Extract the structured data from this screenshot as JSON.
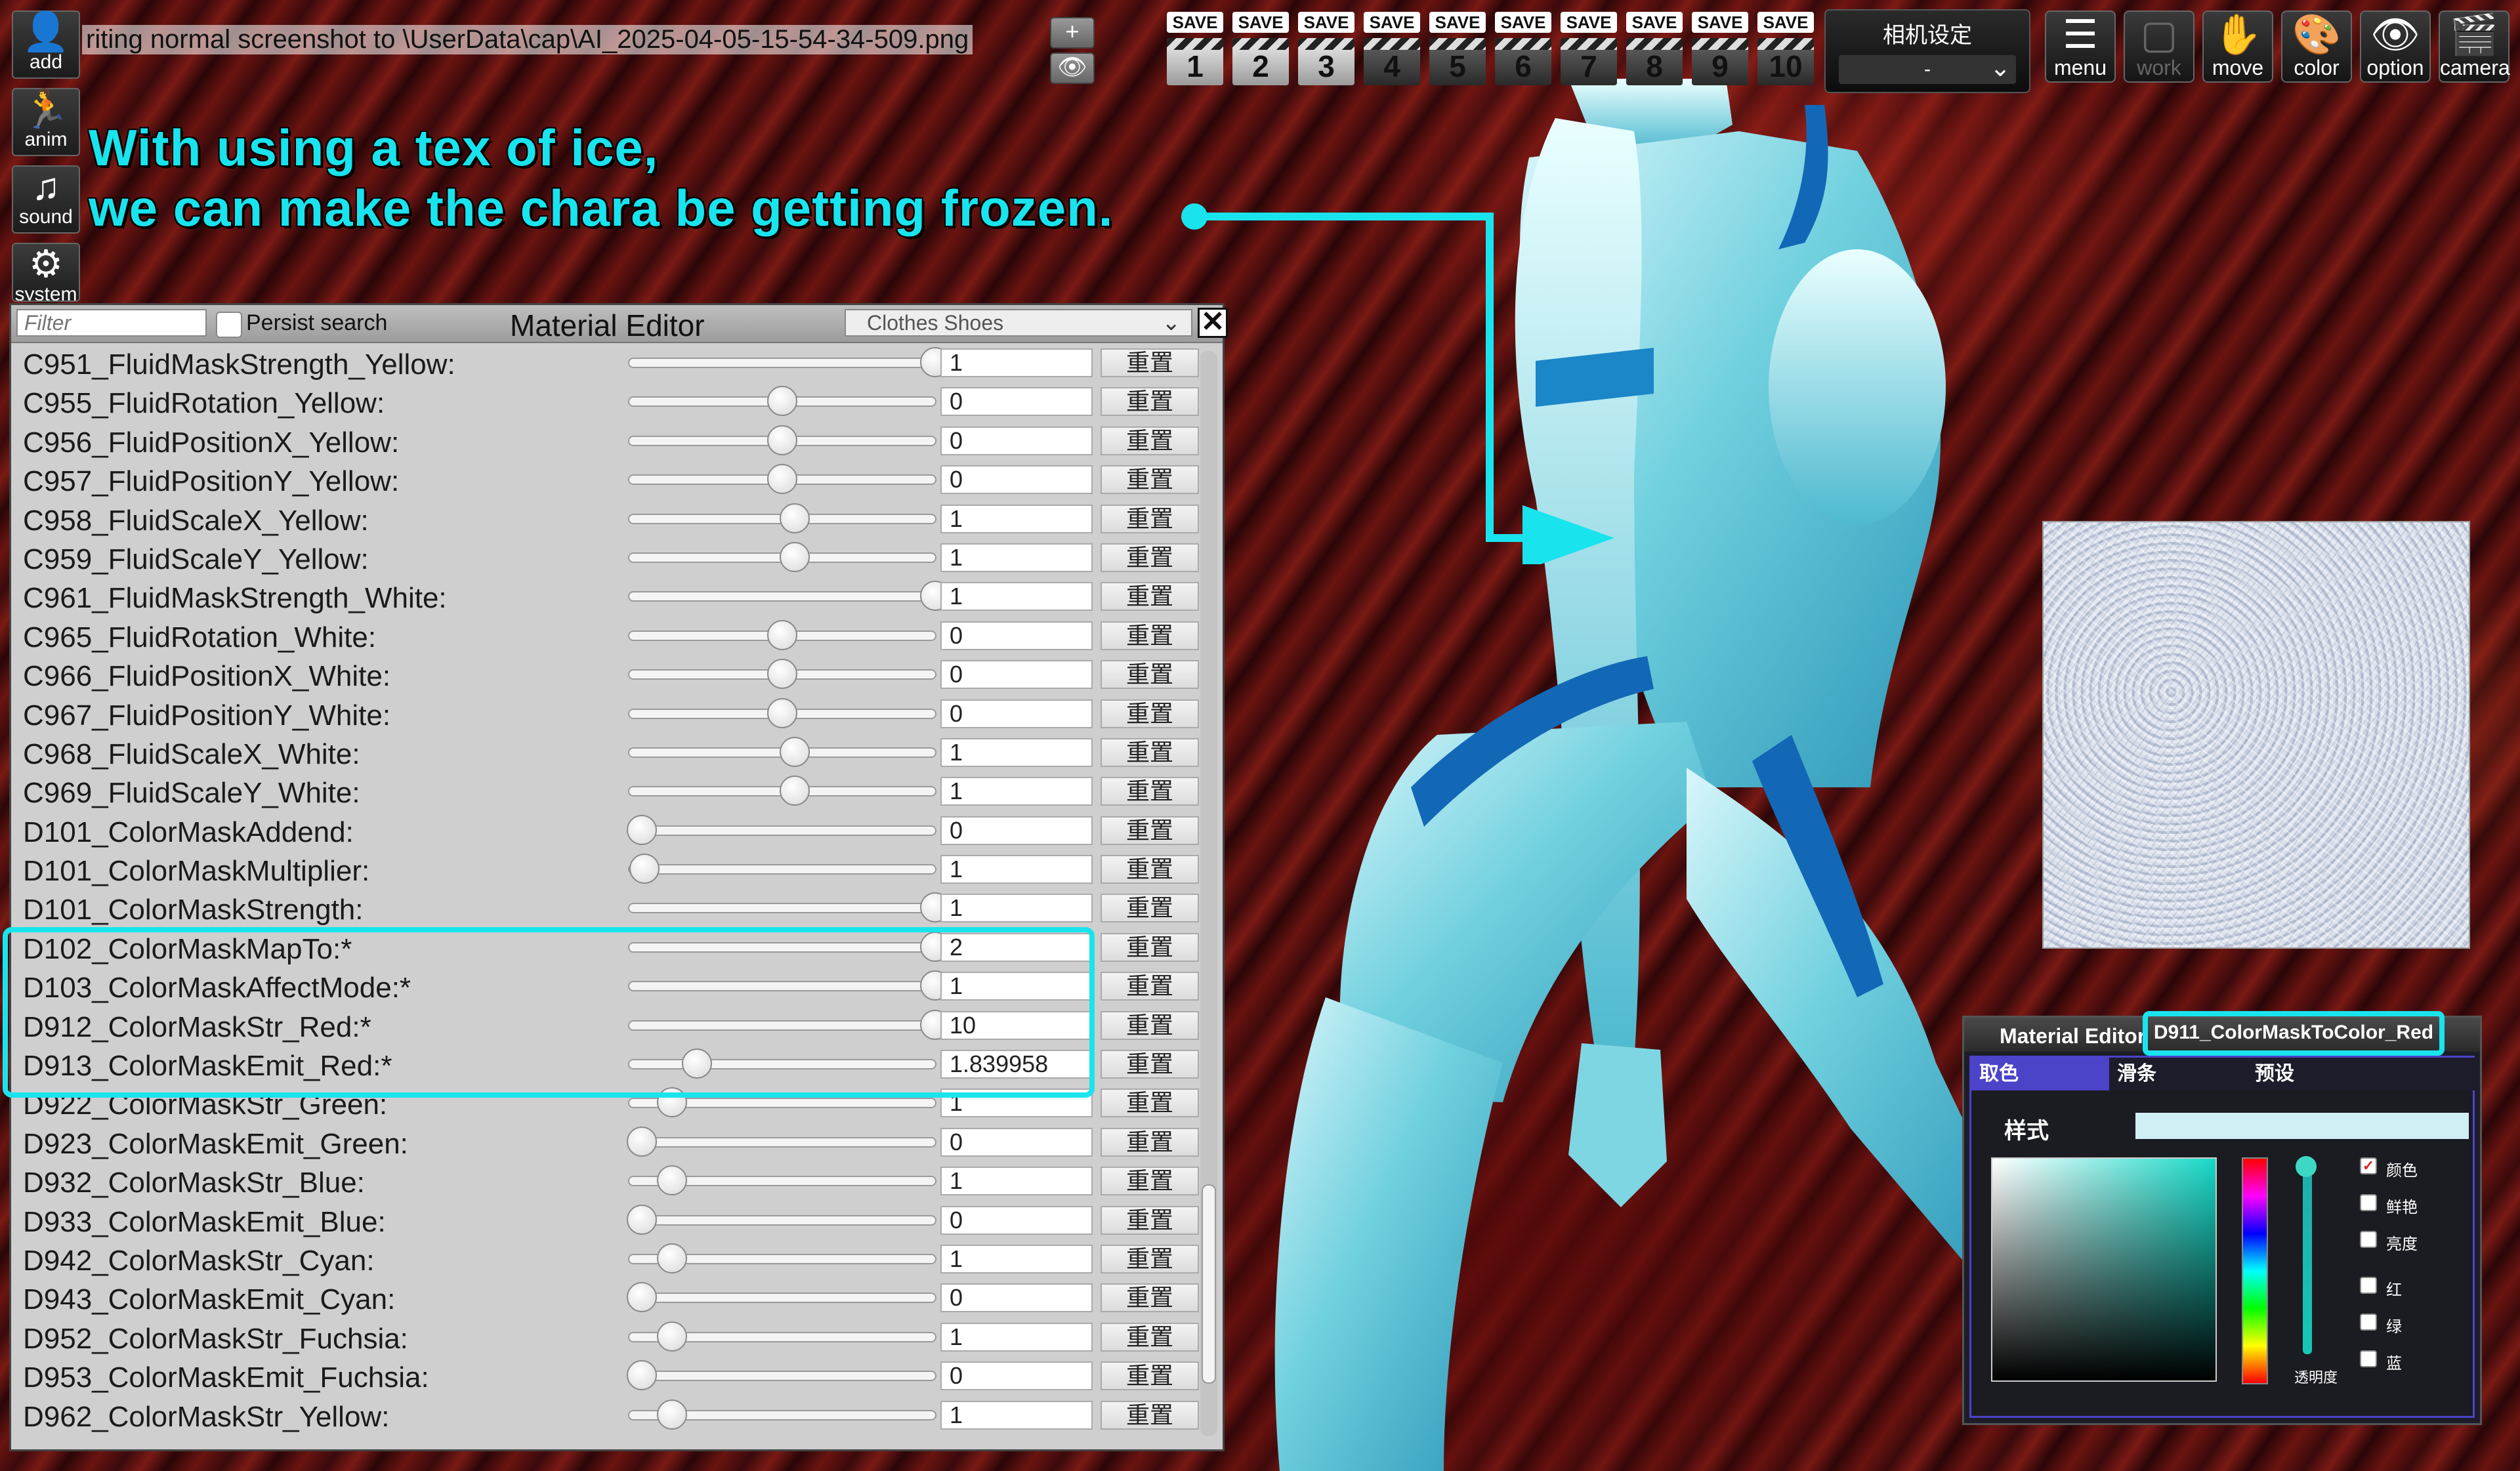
{
  "status": {
    "text": "riting normal screenshot to \\UserData\\cap\\AI_2025-04-05-15-54-34-509.png"
  },
  "left_tools": [
    {
      "label": "add",
      "icon": "add-person-icon"
    },
    {
      "label": "anim",
      "icon": "running-person-icon"
    },
    {
      "label": "sound",
      "icon": "music-note-icon"
    },
    {
      "label": "system",
      "icon": "gears-icon"
    }
  ],
  "caption": {
    "line1": "With using a tex of ice,",
    "line2": "we can make the chara be getting frozen.",
    "color": "#19e4ee"
  },
  "toolbar": {
    "plus": "+",
    "save_label": "SAVE",
    "slots": [
      "1",
      "2",
      "3",
      "4",
      "5",
      "6",
      "7",
      "8",
      "9",
      "10"
    ],
    "camera_setting_title": "相机设定",
    "camera_setting_value": "-",
    "right_tools": [
      {
        "label": "menu",
        "icon": "menu-list-icon"
      },
      {
        "label": "work",
        "icon": "work-icon"
      },
      {
        "label": "move",
        "icon": "hand-icon"
      },
      {
        "label": "color",
        "icon": "palette-icon"
      },
      {
        "label": "option",
        "icon": "eye-icon"
      },
      {
        "label": "camera",
        "icon": "camera-clapper-icon"
      }
    ]
  },
  "material_editor": {
    "filter_placeholder": "Filter",
    "persist_label": "Persist search",
    "title": "Material Editor",
    "category": "Clothes Shoes",
    "close": "✕",
    "reset_label": "重置",
    "rows": [
      {
        "name": "C951_FluidMaskStrength_Yellow:",
        "value": "1",
        "pos": 1.0
      },
      {
        "name": "C955_FluidRotation_Yellow:",
        "value": "0",
        "pos": 0.5
      },
      {
        "name": "C956_FluidPositionX_Yellow:",
        "value": "0",
        "pos": 0.5
      },
      {
        "name": "C957_FluidPositionY_Yellow:",
        "value": "0",
        "pos": 0.5
      },
      {
        "name": "C958_FluidScaleX_Yellow:",
        "value": "1",
        "pos": 0.54
      },
      {
        "name": "C959_FluidScaleY_Yellow:",
        "value": "1",
        "pos": 0.54
      },
      {
        "name": "C961_FluidMaskStrength_White:",
        "value": "1",
        "pos": 1.0
      },
      {
        "name": "C965_FluidRotation_White:",
        "value": "0",
        "pos": 0.5
      },
      {
        "name": "C966_FluidPositionX_White:",
        "value": "0",
        "pos": 0.5
      },
      {
        "name": "C967_FluidPositionY_White:",
        "value": "0",
        "pos": 0.5
      },
      {
        "name": "C968_FluidScaleX_White:",
        "value": "1",
        "pos": 0.54
      },
      {
        "name": "C969_FluidScaleY_White:",
        "value": "1",
        "pos": 0.54
      },
      {
        "name": "D101_ColorMaskAddend:",
        "value": "0",
        "pos": 0.04
      },
      {
        "name": "D101_ColorMaskMultiplier:",
        "value": "1",
        "pos": 0.05
      },
      {
        "name": "D101_ColorMaskStrength:",
        "value": "1",
        "pos": 1.0
      },
      {
        "name": "D102_ColorMaskMapTo:*",
        "value": "2",
        "pos": 1.0
      },
      {
        "name": "D103_ColorMaskAffectMode:*",
        "value": "1",
        "pos": 1.0
      },
      {
        "name": "D912_ColorMaskStr_Red:*",
        "value": "10",
        "pos": 1.0
      },
      {
        "name": "D913_ColorMaskEmit_Red:*",
        "value": "1.839958",
        "pos": 0.22
      },
      {
        "name": "D922_ColorMaskStr_Green:",
        "value": "1",
        "pos": 0.14
      },
      {
        "name": "D923_ColorMaskEmit_Green:",
        "value": "0",
        "pos": 0.04
      },
      {
        "name": "D932_ColorMaskStr_Blue:",
        "value": "1",
        "pos": 0.14
      },
      {
        "name": "D933_ColorMaskEmit_Blue:",
        "value": "0",
        "pos": 0.04
      },
      {
        "name": "D942_ColorMaskStr_Cyan:",
        "value": "1",
        "pos": 0.14
      },
      {
        "name": "D943_ColorMaskEmit_Cyan:",
        "value": "0",
        "pos": 0.04
      },
      {
        "name": "D952_ColorMaskStr_Fuchsia:",
        "value": "1",
        "pos": 0.14
      },
      {
        "name": "D953_ColorMaskEmit_Fuchsia:",
        "value": "0",
        "pos": 0.04
      },
      {
        "name": "D962_ColorMaskStr_Yellow:",
        "value": "1",
        "pos": 0.14
      }
    ]
  },
  "color_picker": {
    "title": "Material Editor",
    "property": "D911_ColorMaskToColor_Red",
    "tabs": [
      "取色",
      "滑条",
      "预设"
    ],
    "style_label": "样式",
    "current_color": "#cfeff4",
    "hue_color": "#17d9c8",
    "alpha_label": "透明度",
    "options": [
      {
        "label": "颜色",
        "checked": true
      },
      {
        "label": "鲜艳",
        "checked": false
      },
      {
        "label": "亮度",
        "checked": false
      },
      {
        "label": "红",
        "checked": false
      },
      {
        "label": "绿",
        "checked": false
      },
      {
        "label": "蓝",
        "checked": false
      }
    ]
  },
  "accent_color": "#19e4ee"
}
